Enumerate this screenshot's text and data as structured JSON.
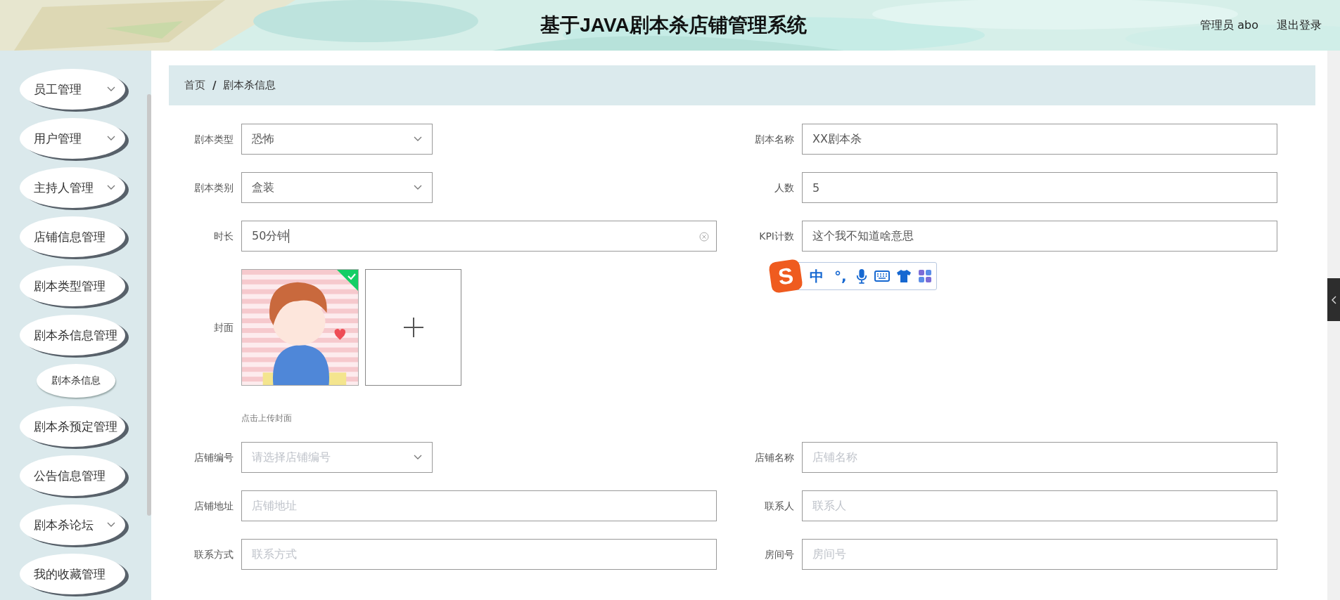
{
  "header": {
    "title": "基于JAVA剧本杀店铺管理系统",
    "user": "管理员 abo",
    "logout": "退出登录"
  },
  "sidebar": {
    "items": [
      {
        "label": "员工管理",
        "expandable": true
      },
      {
        "label": "用户管理",
        "expandable": true
      },
      {
        "label": "主持人管理",
        "expandable": true
      },
      {
        "label": "店铺信息管理",
        "expandable": false
      },
      {
        "label": "剧本类型管理",
        "expandable": false
      },
      {
        "label": "剧本杀信息管理",
        "expandable": false,
        "children": [
          {
            "label": "剧本杀信息"
          }
        ]
      },
      {
        "label": "剧本杀预定管理",
        "expandable": false
      },
      {
        "label": "公告信息管理",
        "expandable": false
      },
      {
        "label": "剧本杀论坛",
        "expandable": true
      },
      {
        "label": "我的收藏管理",
        "expandable": false
      }
    ]
  },
  "breadcrumb": {
    "separator": "/",
    "items": [
      {
        "label": "首页"
      },
      {
        "label": "剧本杀信息"
      }
    ]
  },
  "form": {
    "rows": [
      {
        "left": {
          "label": "剧本类型",
          "kind": "select",
          "value": "恐怖"
        },
        "right": {
          "label": "剧本名称",
          "kind": "input",
          "value": "XX剧本杀"
        }
      },
      {
        "left": {
          "label": "剧本类别",
          "kind": "select",
          "value": "盒装"
        },
        "right": {
          "label": "人数",
          "kind": "input",
          "value": "5"
        }
      },
      {
        "left": {
          "label": "时长",
          "kind": "input",
          "value": "50分钟",
          "clearable": true
        },
        "right": {
          "label": "KPI计数",
          "kind": "input",
          "value": "这个我不知道啥意思"
        }
      },
      {
        "left": {
          "label": "封面",
          "kind": "upload",
          "uploaded": true,
          "hint": "点击上传封面"
        }
      },
      {
        "left": {
          "label": "店铺编号",
          "kind": "select",
          "placeholder": "请选择店铺编号"
        },
        "right": {
          "label": "店铺名称",
          "kind": "input",
          "placeholder": "店铺名称"
        }
      },
      {
        "left": {
          "label": "店铺地址",
          "kind": "input",
          "placeholder": "店铺地址"
        },
        "right": {
          "label": "联系人",
          "kind": "input",
          "placeholder": "联系人"
        }
      },
      {
        "left": {
          "label": "联系方式",
          "kind": "input",
          "placeholder": "联系方式"
        },
        "right": {
          "label": "房间号",
          "kind": "input",
          "placeholder": "房间号"
        }
      }
    ]
  },
  "ime_toolbar": {
    "items": [
      {
        "kind": "logo",
        "label": "S"
      },
      {
        "kind": "text",
        "label": "中"
      },
      {
        "kind": "text",
        "label": "°,"
      },
      {
        "kind": "mic"
      },
      {
        "kind": "keyboard"
      },
      {
        "kind": "skin"
      },
      {
        "kind": "apps"
      }
    ]
  }
}
